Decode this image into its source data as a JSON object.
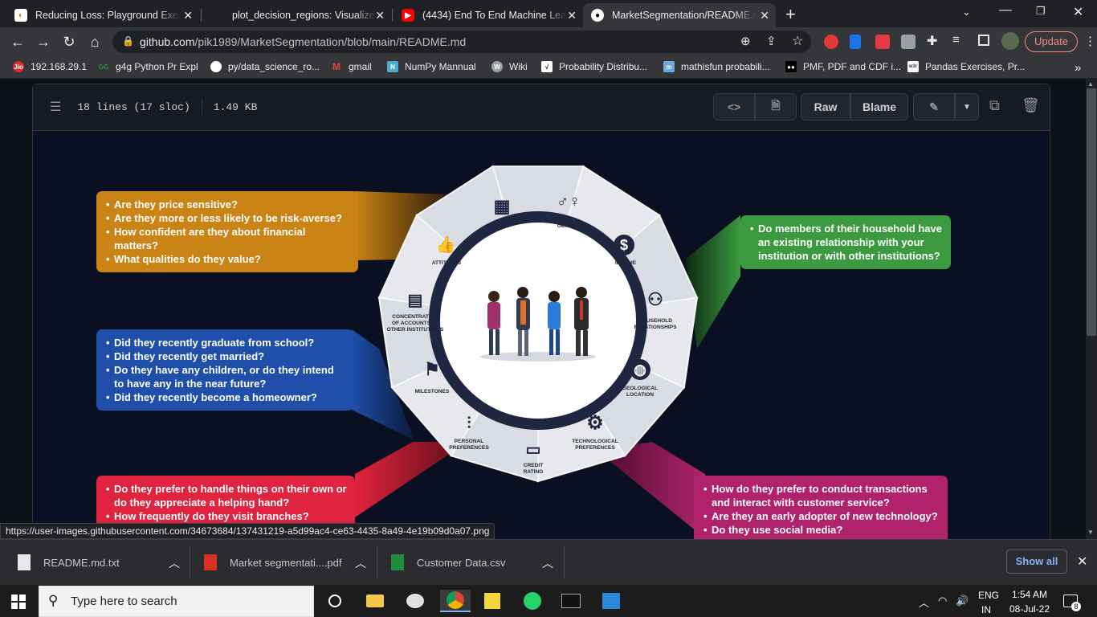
{
  "browser": {
    "tabs": [
      {
        "title": "Reducing Loss: Playground Exerci",
        "favicon": "colab",
        "active": false
      },
      {
        "title": "plot_decision_regions: Visualize t",
        "favicon": "blank",
        "active": false
      },
      {
        "title": "(4434) End To End Machine Learni",
        "favicon": "youtube",
        "active": false
      },
      {
        "title": "MarketSegmentation/README.m",
        "favicon": "github",
        "active": true
      }
    ],
    "url_domain": "github.com",
    "url_path": "/pik1989/MarketSegmentation/blob/main/README.md",
    "update_label": "Update",
    "bookmarks": [
      {
        "label": "192.168.29.1",
        "icon": "jio-icon",
        "color": "#d32f2f",
        "glyph": "Jio"
      },
      {
        "label": "g4g Python Pr Expl",
        "icon": "gfg-icon",
        "color": "#2f8d46",
        "glyph": "GG"
      },
      {
        "label": "py/data_science_ro...",
        "icon": "github-icon",
        "color": "#ffffff",
        "glyph": ""
      },
      {
        "label": "gmail",
        "icon": "gmail-icon",
        "color": "#ea4335",
        "glyph": "M"
      },
      {
        "label": "NumPy Mannual",
        "icon": "numpy-icon",
        "color": "#4dabcf",
        "glyph": "N"
      },
      {
        "label": "Wiki",
        "icon": "wiki-icon",
        "color": "#9aa0a6",
        "glyph": "W"
      },
      {
        "label": "Probability Distribu...",
        "icon": "chart-icon",
        "color": "#ffffff",
        "glyph": "√"
      },
      {
        "label": "mathisfun probabili...",
        "icon": "mathisfun-icon",
        "color": "#6fa8dc",
        "glyph": "m"
      },
      {
        "label": "PMF, PDF and CDF i...",
        "icon": "medium-icon",
        "color": "#000000",
        "glyph": "●●"
      },
      {
        "label": "Pandas Exercises, Pr...",
        "icon": "w3r-icon",
        "color": "#ffffff",
        "glyph": "w3r"
      }
    ],
    "bookmarks_more": "»"
  },
  "github": {
    "file_lines": "18 lines (17 sloc)",
    "file_size": "1.49 KB",
    "raw_label": "Raw",
    "blame_label": "Blame"
  },
  "infographic": {
    "segments": [
      {
        "label": "AGE"
      },
      {
        "label": "GENDER"
      },
      {
        "label": "INCOME"
      },
      {
        "label": "HOUSEHOLD\nRELATIONSHIPS"
      },
      {
        "label": "GEOLOGICAL\nLOCATION"
      },
      {
        "label": "TECHNOLOGICAL\nPREFERENCES"
      },
      {
        "label": "CREDIT\nRATING"
      },
      {
        "label": "PERSONAL\nPREFERENCES"
      },
      {
        "label": "MILESTONES"
      },
      {
        "label": "CONCENTRATION\nOF ACCOUNTS AT\nOTHER INSTITUTIONS"
      },
      {
        "label": "ATTITUDES"
      }
    ],
    "boxes": {
      "attitudes": {
        "color": "#c98415",
        "items": [
          "Are they price sensitive?",
          "Are they more or less likely to be risk-averse?",
          "How confident are they about financial matters?",
          "What qualities do they value?"
        ]
      },
      "household": {
        "color": "#3b9a3f",
        "items": [
          "Do members of their household have an existing relationship with your institution or with other institutions?"
        ]
      },
      "milestones": {
        "color": "#1f4fa8",
        "items": [
          "Did they recently graduate from school?",
          "Did they recently get married?",
          "Do they have any children, or do they intend to have any in the near future?",
          "Did they recently become a homeowner?"
        ]
      },
      "personal": {
        "color": "#e0233e",
        "items": [
          "Do they prefer to handle things on their own or do they appreciate a helping hand?",
          "How frequently do they visit branches?"
        ]
      },
      "technological": {
        "color": "#b0236b",
        "items": [
          "How do they prefer to conduct transactions and interact with customer service?",
          "Are they an early adopter of new technology?",
          "Do they use social media?"
        ]
      }
    }
  },
  "status_link": "https://user-images.githubusercontent.com/34673684/137431219-a5d99ac4-ce63-4435-8a49-4e19b09d0a07.png",
  "downloads": [
    {
      "name": "README.md.txt",
      "type": "txt"
    },
    {
      "name": "Market segmentati....pdf",
      "type": "pdf"
    },
    {
      "name": "Customer Data.csv",
      "type": "csv"
    }
  ],
  "show_all_label": "Show all",
  "taskbar": {
    "search_placeholder": "Type here to search",
    "lang_top": "ENG",
    "lang_bottom": "IN",
    "time": "1:54 AM",
    "date": "08-Jul-22",
    "notification_count": "8"
  }
}
